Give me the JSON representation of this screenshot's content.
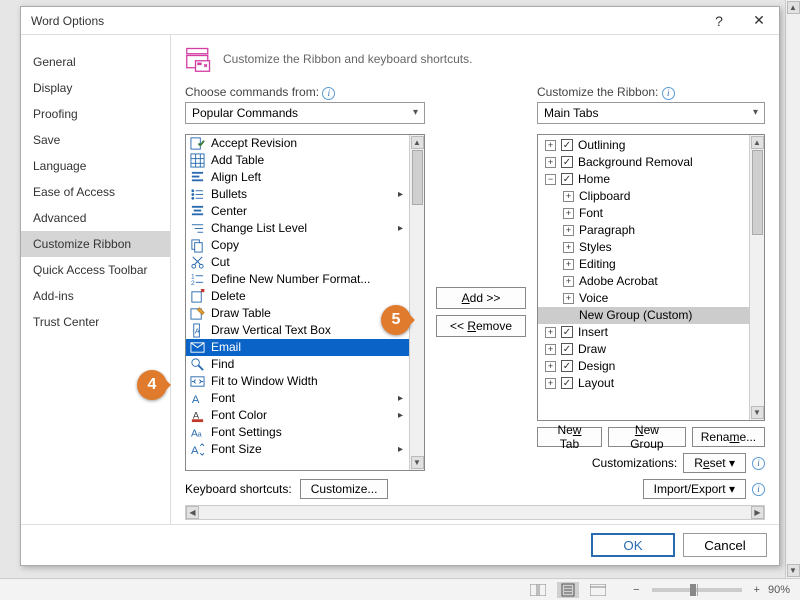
{
  "title": "Word Options",
  "subtitle": "Customize the Ribbon and keyboard shortcuts.",
  "sidenav": {
    "items": [
      {
        "label": "General"
      },
      {
        "label": "Display"
      },
      {
        "label": "Proofing"
      },
      {
        "label": "Save"
      },
      {
        "label": "Language"
      },
      {
        "label": "Ease of Access"
      },
      {
        "label": "Advanced"
      },
      {
        "label": "Customize Ribbon",
        "selected": true
      },
      {
        "label": "Quick Access Toolbar"
      },
      {
        "label": "Add-ins"
      },
      {
        "label": "Trust Center"
      }
    ]
  },
  "commands_label": "Choose commands from:",
  "commands_dropdown": "Popular Commands",
  "ribbon_label": "Customize the Ribbon:",
  "ribbon_dropdown": "Main Tabs",
  "commands": [
    {
      "label": "Accept Revision",
      "icon": "accept"
    },
    {
      "label": "Add Table",
      "icon": "table"
    },
    {
      "label": "Align Left",
      "icon": "align-left"
    },
    {
      "label": "Bullets",
      "icon": "bullets",
      "submenu": true
    },
    {
      "label": "Center",
      "icon": "center"
    },
    {
      "label": "Change List Level",
      "icon": "list-level",
      "submenu": true
    },
    {
      "label": "Copy",
      "icon": "copy"
    },
    {
      "label": "Cut",
      "icon": "cut"
    },
    {
      "label": "Define New Number Format...",
      "icon": "number-format"
    },
    {
      "label": "Delete",
      "icon": "delete"
    },
    {
      "label": "Draw Table",
      "icon": "draw-table"
    },
    {
      "label": "Draw Vertical Text Box",
      "icon": "vtextbox"
    },
    {
      "label": "Email",
      "icon": "email",
      "selected": true
    },
    {
      "label": "Find",
      "icon": "find"
    },
    {
      "label": "Fit to Window Width",
      "icon": "fit-window"
    },
    {
      "label": "Font",
      "icon": "font",
      "submenu": true
    },
    {
      "label": "Font Color",
      "icon": "font-color",
      "submenu": true
    },
    {
      "label": "Font Settings",
      "icon": "font-settings"
    },
    {
      "label": "Font Size",
      "icon": "font-size",
      "submenu": true
    }
  ],
  "tree": [
    {
      "indent": 0,
      "exp": "+",
      "chk": true,
      "label": "Outlining"
    },
    {
      "indent": 0,
      "exp": "+",
      "chk": true,
      "label": "Background Removal"
    },
    {
      "indent": 0,
      "exp": "-",
      "chk": true,
      "label": "Home"
    },
    {
      "indent": 1,
      "exp": "+",
      "label": "Clipboard"
    },
    {
      "indent": 1,
      "exp": "+",
      "label": "Font"
    },
    {
      "indent": 1,
      "exp": "+",
      "label": "Paragraph"
    },
    {
      "indent": 1,
      "exp": "+",
      "label": "Styles"
    },
    {
      "indent": 1,
      "exp": "+",
      "label": "Editing"
    },
    {
      "indent": 1,
      "exp": "+",
      "label": "Adobe Acrobat"
    },
    {
      "indent": 1,
      "exp": "+",
      "label": "Voice"
    },
    {
      "indent": 1,
      "exp": "",
      "label": "New Group (Custom)",
      "sel": true
    },
    {
      "indent": 0,
      "exp": "+",
      "chk": true,
      "label": "Insert"
    },
    {
      "indent": 0,
      "exp": "+",
      "chk": true,
      "label": "Draw"
    },
    {
      "indent": 0,
      "exp": "+",
      "chk": true,
      "label": "Design"
    },
    {
      "indent": 0,
      "exp": "+",
      "chk": true,
      "label": "Layout"
    }
  ],
  "buttons": {
    "add": "Add >>",
    "remove": "<< Remove",
    "new_tab": "New Tab",
    "new_group": "New Group",
    "rename": "Rename...",
    "reset": "Reset",
    "import_export": "Import/Export",
    "customize": "Customize...",
    "ok": "OK",
    "cancel": "Cancel"
  },
  "labels": {
    "customizations": "Customizations:",
    "keyboard_shortcuts": "Keyboard shortcuts:"
  },
  "callouts": {
    "c4": "4",
    "c5": "5"
  },
  "status": {
    "zoom_pct": "90%",
    "plus": "+",
    "minus": "−"
  }
}
